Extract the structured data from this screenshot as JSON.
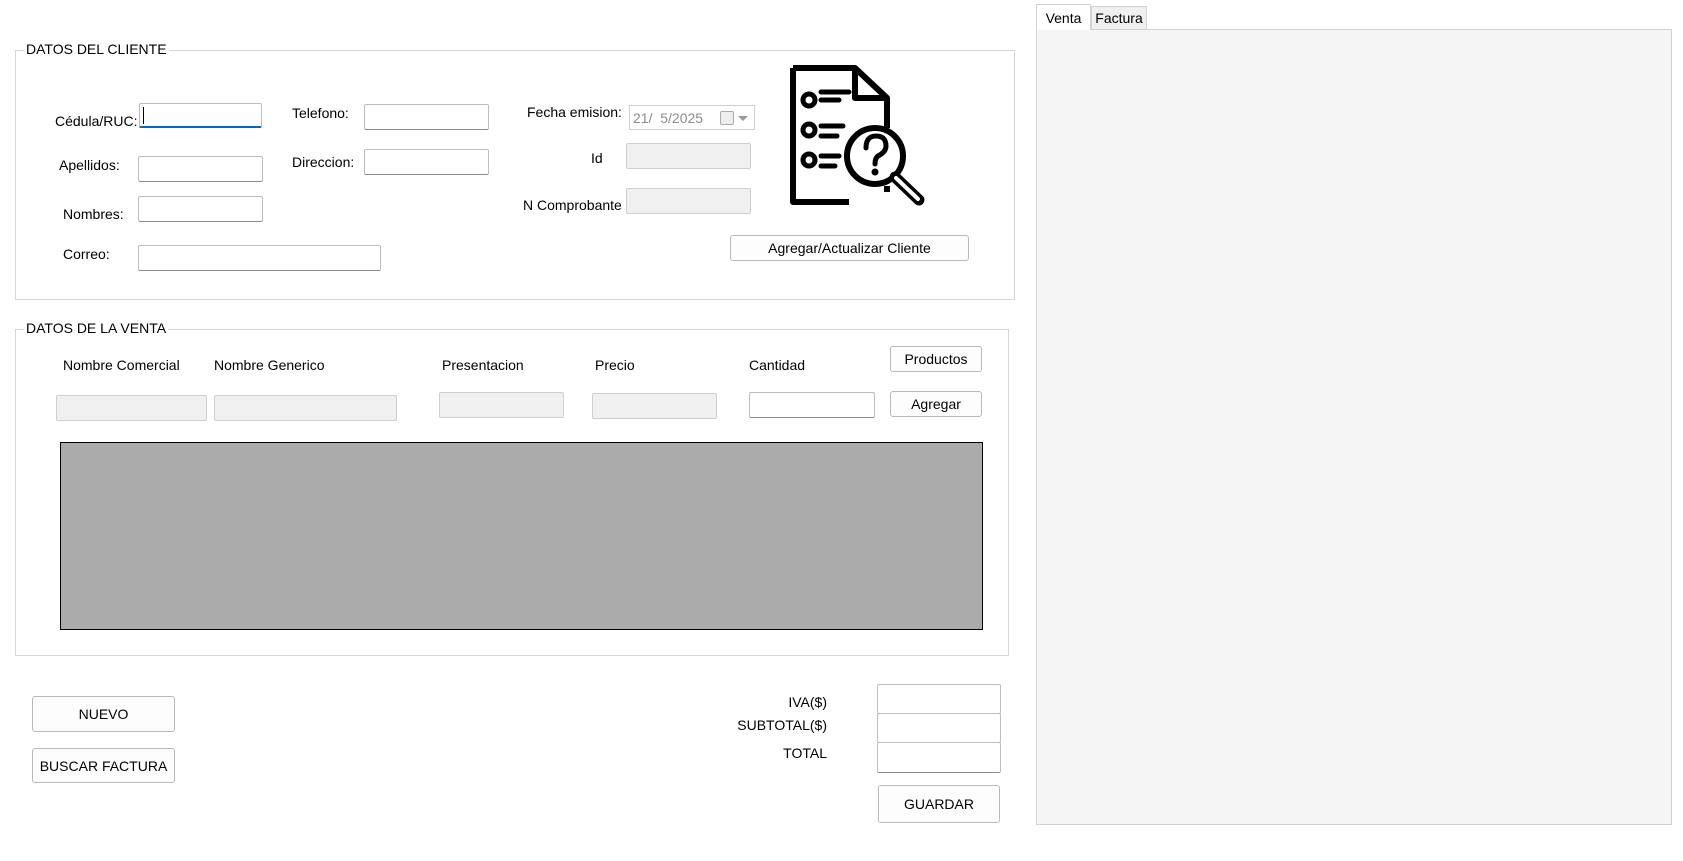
{
  "cliente": {
    "legend": "DATOS DEL CLIENTE",
    "cedula_label": "Cédula/RUC:",
    "cedula_value": "",
    "apellidos_label": "Apellidos:",
    "nombres_label": "Nombres:",
    "correo_label": "Correo:",
    "telefono_label": "Telefono:",
    "direccion_label": "Direccion:",
    "fecha_label": "Fecha emision:",
    "fecha_value": "21/  5/2025",
    "id_label": "Id",
    "comprobante_label": "N Comprobante",
    "agregar_btn": "Agregar/Actualizar Cliente",
    "illustration_icon": "invoice-search-icon"
  },
  "venta": {
    "legend": "DATOS DE LA VENTA",
    "col_nombre_comercial": "Nombre Comercial",
    "col_nombre_generico": "Nombre Generico",
    "col_presentacion": "Presentacion",
    "col_precio": "Precio",
    "col_cantidad": "Cantidad",
    "productos_btn": "Productos",
    "agregar_btn": "Agregar"
  },
  "totales": {
    "iva_label": "IVA($)",
    "subtotal_label": "SUBTOTAL($)",
    "total_label": "TOTAL",
    "guardar_btn": "GUARDAR"
  },
  "acciones": {
    "nuevo_btn": "NUEVO",
    "buscar_btn": "BUSCAR FACTURA"
  },
  "tabs": [
    {
      "label": "Venta",
      "active": true
    },
    {
      "label": "Factura",
      "active": false
    }
  ]
}
